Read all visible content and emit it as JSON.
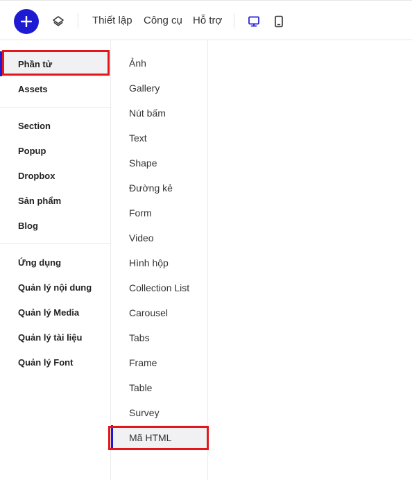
{
  "topbar": {
    "add_icon": "plus-icon",
    "layers_icon": "layers-icon",
    "menu": [
      "Thiết lập",
      "Công cụ",
      "Hỗ trợ"
    ],
    "devices": [
      "desktop-icon",
      "tablet-icon"
    ],
    "accent_color": "#1e1ad3"
  },
  "sidebar": {
    "items": [
      "Phần tử",
      "Assets",
      "Section",
      "Popup",
      "Dropbox",
      "Sản phẩm",
      "Blog",
      "Ứng dụng",
      "Quản lý nội dung",
      "Quản lý Media",
      "Quản lý tài liệu",
      "Quản lý Font"
    ],
    "active": "Phần tử"
  },
  "subpanel": {
    "items": [
      "Ảnh",
      "Gallery",
      "Nút bấm",
      "Text",
      "Shape",
      "Đường kẻ",
      "Form",
      "Video",
      "Hình hộp",
      "Collection List",
      "Carousel",
      "Tabs",
      "Frame",
      "Table",
      "Survey",
      "Mã HTML"
    ],
    "active": "Mã HTML"
  },
  "annotation_color": "#e3161b"
}
